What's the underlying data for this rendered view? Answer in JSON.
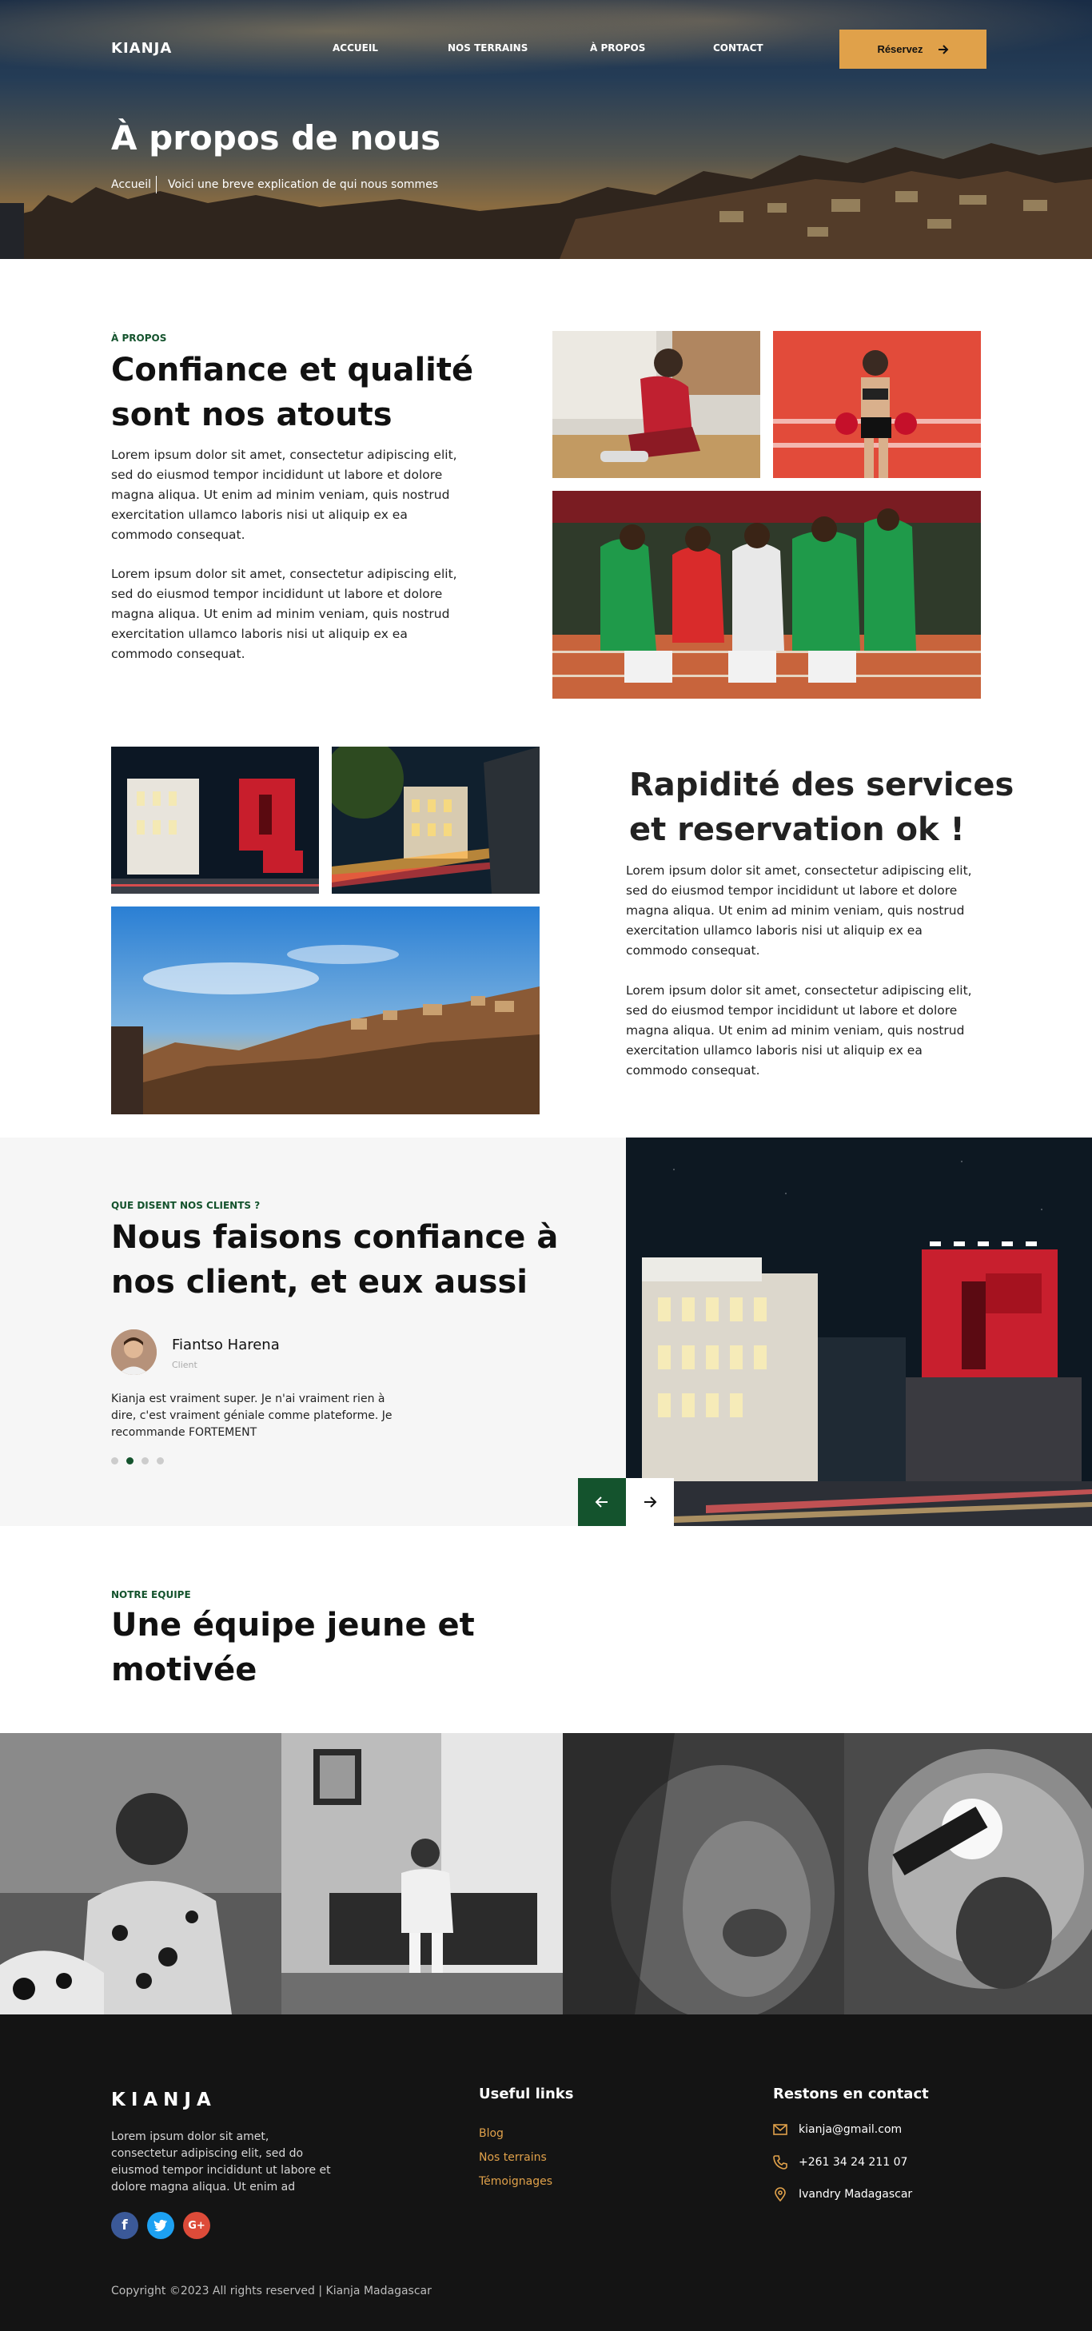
{
  "header": {
    "logo": "KIANJA",
    "nav": [
      "ACCUEIL",
      "NOS TERRAINS",
      "À PROPOS",
      "CONTACT"
    ],
    "cta_label": "Réservez"
  },
  "hero": {
    "title": "À propos de nous",
    "breadcrumb_home": "Accueil",
    "breadcrumb_text": "Voici une breve explication de qui nous sommes"
  },
  "about": {
    "eyebrow": "À PROPOS",
    "title": "Confiance et qualité sont nos atouts",
    "paragraphs": [
      "Lorem ipsum dolor sit amet, consectetur adipiscing elit, sed do eiusmod tempor incididunt ut labore et dolore magna aliqua. Ut enim ad minim veniam, quis nostrud exercitation ullamco laboris nisi ut aliquip ex ea commodo consequat.",
      "Lorem ipsum dolor sit amet, consectetur adipiscing elit, sed do eiusmod tempor incididunt ut labore et dolore magna aliqua. Ut enim ad minim veniam, quis nostrud exercitation ullamco laboris nisi ut aliquip ex ea commodo consequat."
    ]
  },
  "services": {
    "title": "Rapidité des services et reservation ok !",
    "paragraphs": [
      "Lorem ipsum dolor sit amet, consectetur adipiscing elit, sed do eiusmod tempor incididunt ut labore et dolore magna aliqua. Ut enim ad minim veniam, quis nostrud exercitation ullamco laboris nisi ut aliquip ex ea commodo consequat.",
      "Lorem ipsum dolor sit amet, consectetur adipiscing elit, sed do eiusmod tempor incididunt ut labore et dolore magna aliqua. Ut enim ad minim veniam, quis nostrud exercitation ullamco laboris nisi ut aliquip ex ea commodo consequat."
    ]
  },
  "testimonials": {
    "eyebrow": "QUE DISENT NOS CLIENTS ?",
    "title": "Nous faisons confiance à nos client, et eux aussi",
    "name": "Fiantso Harena",
    "role": "Client",
    "quote": "Kianja est vraiment super. Je n'ai vraiment rien à dire, c'est vraiment géniale comme plateforme. Je recommande FORTEMENT",
    "active_slide": 2,
    "slide_count": 4
  },
  "team": {
    "eyebrow": "NOTRE EQUIPE",
    "title": "Une équipe jeune et motivée"
  },
  "footer": {
    "logo": "KIANJA",
    "description": "Lorem ipsum dolor sit amet, consectetur adipiscing elit, sed do eiusmod tempor incididunt ut labore et dolore magna aliqua. Ut enim ad",
    "useful_links_title": "Useful links",
    "links": [
      "Blog",
      "Nos terrains",
      "Témoignages"
    ],
    "contact_title": "Restons en contact",
    "email": "kianja@gmail.com",
    "phone": "+261 34 24 211 07",
    "address": "Ivandry Madagascar",
    "copyright": "Copyright ©2023 All rights reserved | Kianja Madagascar",
    "social": [
      "f",
      "G+"
    ]
  },
  "colors": {
    "accent": "#e0a14a",
    "green": "#14532d",
    "footer_bg": "#141414",
    "facebook": "#3b5998",
    "twitter": "#1da1f2",
    "google": "#dd4b39"
  }
}
